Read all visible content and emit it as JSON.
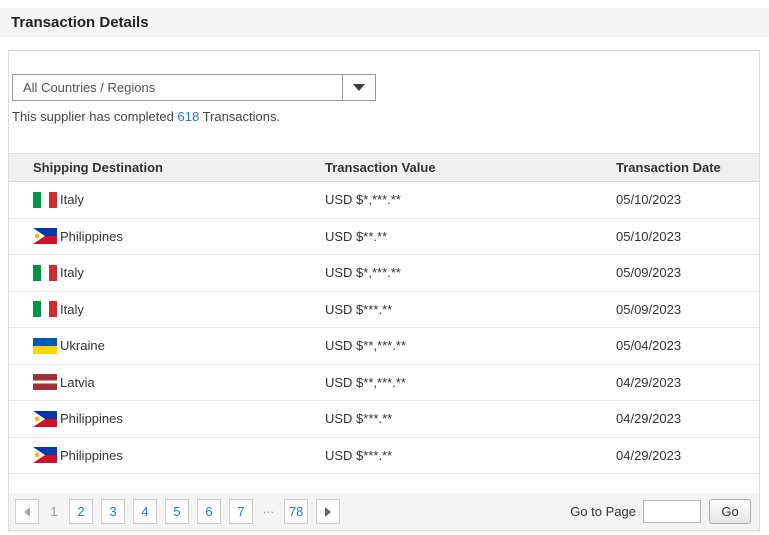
{
  "title": "Transaction Details",
  "filter": {
    "value": "All Countries / Regions"
  },
  "summary": {
    "prefix": "This supplier has completed ",
    "count": "618",
    "suffix": " Transactions."
  },
  "table": {
    "headers": [
      "Shipping Destination",
      "Transaction Value",
      "Transaction Date"
    ],
    "rows": [
      {
        "country": "Italy",
        "flag": "italy",
        "value": "USD $*,***.**",
        "date": "05/10/2023"
      },
      {
        "country": "Philippines",
        "flag": "philippines",
        "value": "USD $**.**",
        "date": "05/10/2023"
      },
      {
        "country": "Italy",
        "flag": "italy",
        "value": "USD $*,***.**",
        "date": "05/09/2023"
      },
      {
        "country": "Italy",
        "flag": "italy",
        "value": "USD $***.**",
        "date": "05/09/2023"
      },
      {
        "country": "Ukraine",
        "flag": "ukraine",
        "value": "USD $**,***.**",
        "date": "05/04/2023"
      },
      {
        "country": "Latvia",
        "flag": "latvia",
        "value": "USD $**,***.**",
        "date": "04/29/2023"
      },
      {
        "country": "Philippines",
        "flag": "philippines",
        "value": "USD $***.**",
        "date": "04/29/2023"
      },
      {
        "country": "Philippines",
        "flag": "philippines",
        "value": "USD $***.**",
        "date": "04/29/2023"
      }
    ]
  },
  "pagination": {
    "current": "1",
    "pages": [
      "1",
      "2",
      "3",
      "4",
      "5",
      "6",
      "7",
      "...",
      "78"
    ],
    "goto_label": "Go to Page",
    "goto_value": "",
    "go_button": "Go"
  },
  "colors": {
    "link": "#2979d9",
    "title_bar_bg": "#f5f5f5",
    "table_header_bg": "#f0f0f0",
    "pagination_bar_bg": "#f4f4f4"
  }
}
